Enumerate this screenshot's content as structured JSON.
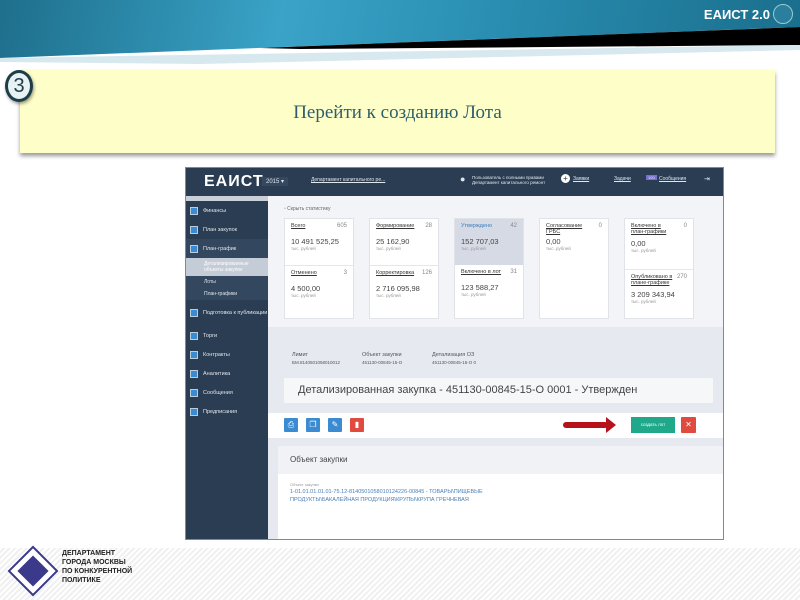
{
  "slide": {
    "brand": "ЕАИСТ 2.0",
    "step": "3",
    "instruction": "Перейти к созданию Лота",
    "org_logo_text": "ДЕПАРТАМЕНТ ГОРОДА МОСКВЫ ПО КОНКУРЕНТНОЙ ПОЛИТИКЕ",
    "org_lines": [
      "ДЕПАРТАМЕНТ",
      "ГОРОДА МОСКВЫ",
      "ПО КОНКУРЕНТНОЙ",
      "ПОЛИТИКЕ"
    ]
  },
  "app": {
    "logo": "ЕАИСТ",
    "year": "2015",
    "org_select": "Департамент капитального ре...",
    "user_line1": "Пользователь с полными правами",
    "user_line2": "Департамент капитального ремонт",
    "nav": {
      "requests": "Заявки",
      "tasks": "Задачи",
      "messages_badge": "100",
      "messages": "Сообщения"
    },
    "sidebar": [
      {
        "label": "Финансы"
      },
      {
        "label": "План закупок"
      },
      {
        "label": "План-график"
      }
    ],
    "sidebar_sub": [
      "Детализированные объекты закупок",
      "Лоты",
      "План-графики"
    ],
    "sidebar2": [
      {
        "label": "Подготовка к публикации"
      },
      {
        "label": "Торги"
      },
      {
        "label": "Контракты"
      },
      {
        "label": "Аналитика"
      },
      {
        "label": "Сообщения"
      },
      {
        "label": "Предписания"
      }
    ],
    "hide_stats": "Скрыть статистику",
    "unit": "тыс. рублей",
    "cards": [
      {
        "top": {
          "label": "Всего",
          "count": "605",
          "value": "10 491 525,25"
        },
        "bottom": {
          "label": "Отменено",
          "count": "3",
          "value": "4 500,00"
        }
      },
      {
        "top": {
          "label": "Формирование",
          "count": "28",
          "value": "25 162,90"
        },
        "bottom": {
          "label": "Корректировка",
          "count": "126",
          "value": "2 716 095,98"
        }
      },
      {
        "top": {
          "label": "Утверждено",
          "count": "42",
          "value": "152 707,03"
        },
        "bottom": {
          "label": "Включено в лот",
          "count": "31",
          "value": "123 588,27"
        }
      },
      {
        "top": {
          "label": "Согласование ГРБС",
          "count": "0",
          "value": "0,00"
        }
      },
      {
        "top": {
          "label": "Включено в план-графики",
          "count": "0",
          "value": "0,00"
        },
        "bottom": {
          "label": "Опубликовано в плане-графике",
          "count": "270",
          "value": "3 209 343,94"
        }
      }
    ],
    "info": [
      {
        "label": "Лимит",
        "value": "БМ.8140501058010012"
      },
      {
        "label": "Объект закупки",
        "value": "451130-00845-15-О"
      },
      {
        "label": "Детализация ОЗ",
        "value": "451130-00845-15-О 0"
      }
    ],
    "title": "Детализированная закупка - 451130-00845-15-О 0001 - Утвержден",
    "create_lot": "создать лот",
    "object_header": "Объект закупки",
    "object_label": "Объект закупки",
    "object_value": "1-01.01.01.01.01-75.12-8140501058010124226-00845 - ТОВАРЫ\\ПИЩЕВЫЕ ПРОДУКТЫ\\БАКАЛЕЙНАЯ ПРОДУКЦИЯ\\КРУПЫ\\КРУПА ГРЕЧНЕВАЯ"
  },
  "colors": {
    "accent_green": "#1fa88a",
    "danger": "#e04a3f",
    "primary": "#3a8bd1",
    "arrow": "#b5121b"
  }
}
